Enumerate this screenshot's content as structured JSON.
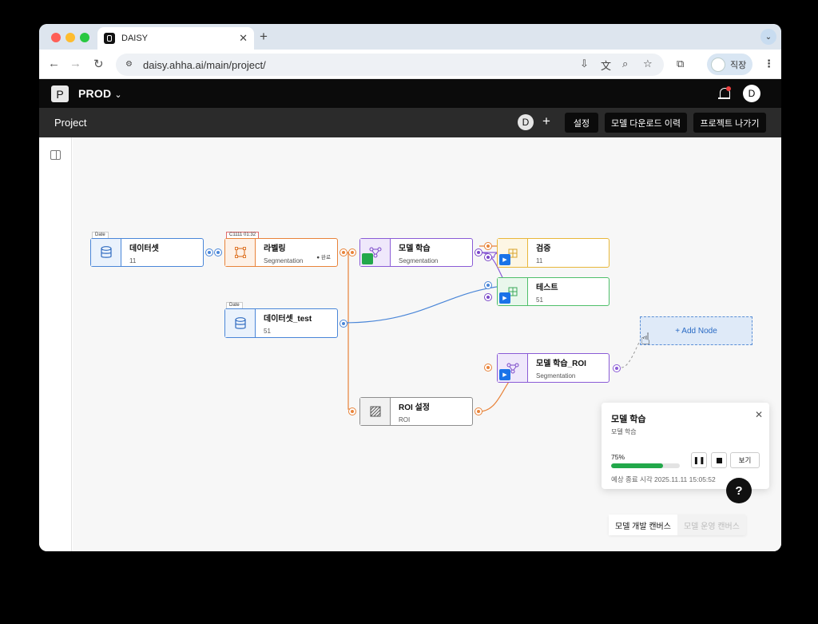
{
  "browser": {
    "tab_title": "DAISY",
    "url": "daisy.ahha.ai/main/project/",
    "profile_label": "직장",
    "traffic_colors": [
      "#ff5f57",
      "#febc2e",
      "#28c840"
    ]
  },
  "app": {
    "workspace": "PROD",
    "user_initial": "D"
  },
  "project": {
    "title": "Project",
    "member_initial": "D",
    "buttons": {
      "settings": "설정",
      "download_history": "모델 다운로드 이력",
      "leave": "프로젝트 나가기"
    }
  },
  "nodes": {
    "dataset": {
      "tag": "Date",
      "title": "데이터셋",
      "sub": "11",
      "color": "#4a86d8"
    },
    "labeling": {
      "tag": "C1111 01:32",
      "title": "라벨링",
      "sub": "Segmentation",
      "status": "● 완료",
      "color": "#e8833a"
    },
    "dataset_test": {
      "tag": "Date",
      "title": "데이터셋_test",
      "sub": "51",
      "color": "#4a86d8"
    },
    "train": {
      "title": "모델 학습",
      "sub": "Segmentation",
      "color": "#8a5bd6"
    },
    "verify": {
      "title": "검증",
      "sub": "11",
      "color": "#e8b73a"
    },
    "test": {
      "title": "테스트",
      "sub": "51",
      "color": "#4fbf6a"
    },
    "roi": {
      "title": "ROI 설정",
      "sub": "ROI",
      "color": "#888888"
    },
    "train_roi": {
      "title": "모델 학습_ROI",
      "sub": "Segmentation",
      "color": "#8a5bd6"
    },
    "add_node": "+ Add Node"
  },
  "progress_panel": {
    "title": "모델 학습",
    "subtitle": "모델 학습",
    "percent_label": "75%",
    "progress": 0.75,
    "view": "보기",
    "eta": "예상 종료 시각 2025.11.11 15:05:52"
  },
  "help_label": "?",
  "canvas_tabs": {
    "dev": "모델 개발 캔버스",
    "ops": "모델 운영 캔버스"
  },
  "icon": "▶"
}
